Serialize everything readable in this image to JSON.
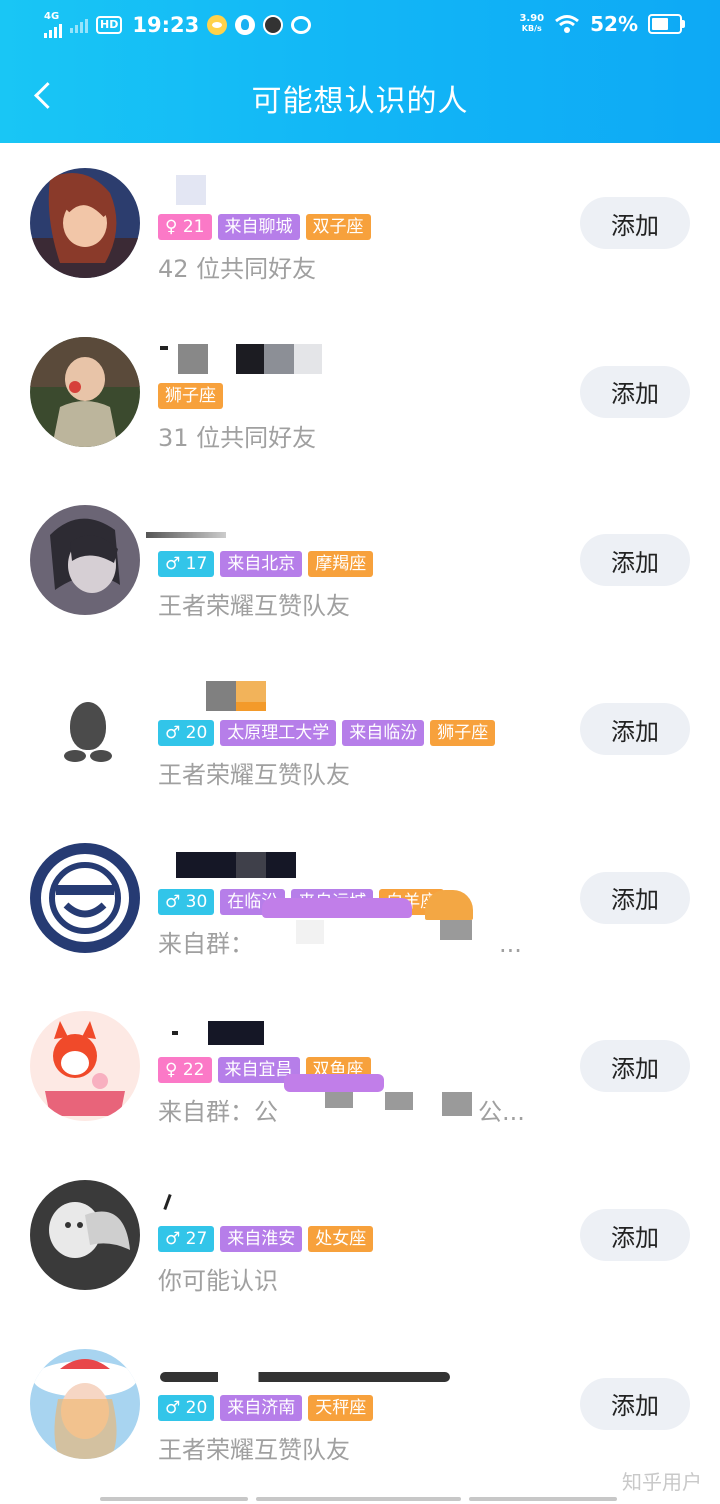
{
  "status_bar": {
    "network": "4G",
    "hd": "HD",
    "time": "19:23",
    "net_speed_value": "3.90",
    "net_speed_unit": "KB/s",
    "battery": "52%",
    "battery_level": 0.52,
    "icons": [
      "signal-icon",
      "cat-app-icon",
      "qq-app-icon",
      "dog-app-icon",
      "weibo-icon",
      "wifi-icon",
      "battery-icon"
    ]
  },
  "header": {
    "title": "可能想认识的人",
    "back_icon": "chevron-left-icon",
    "background_color": "#12b6f6"
  },
  "colors": {
    "female_tag": "#fb79c7",
    "male_tag": "#32c5e9",
    "place_tag": "#b67ee9",
    "zodiac_tag": "#f7a13c",
    "add_button_bg": "#edf0f5"
  },
  "people": [
    {
      "gender_age": "♀ 21",
      "tags": [
        "来自聊城",
        "双子座"
      ],
      "subtitle": "42 位共同好友",
      "add_label": "添加"
    },
    {
      "tags": [
        "狮子座"
      ],
      "subtitle": "31 位共同好友",
      "add_label": "添加"
    },
    {
      "gender_age": "♂ 17",
      "tags": [
        "来自北京",
        "摩羯座"
      ],
      "subtitle": "王者荣耀互赞队友",
      "add_label": "添加"
    },
    {
      "gender_age": "♂ 20",
      "tags": [
        "太原理工大学",
        "来自临汾",
        "狮子座"
      ],
      "subtitle": "王者荣耀互赞队友",
      "add_label": "添加"
    },
    {
      "gender_age": "♂ 30",
      "tags": [
        "在临汾",
        "来自运城",
        "白羊座"
      ],
      "subtitle_prefix": "来自群：",
      "subtitle_suffix": "...",
      "add_label": "添加"
    },
    {
      "gender_age": "♀ 22",
      "tags": [
        "来自宜昌",
        "双鱼座"
      ],
      "subtitle_prefix": "来自群：公",
      "subtitle_suffix": "公...",
      "add_label": "添加"
    },
    {
      "gender_age": "♂ 27",
      "tags": [
        "来自淮安",
        "处女座"
      ],
      "subtitle": "你可能认识",
      "add_label": "添加"
    },
    {
      "gender_age": "♂ 20",
      "tags": [
        "来自济南",
        "天秤座"
      ],
      "subtitle": "王者荣耀互赞队友",
      "add_label": "添加"
    }
  ],
  "watermark": "知乎用户"
}
